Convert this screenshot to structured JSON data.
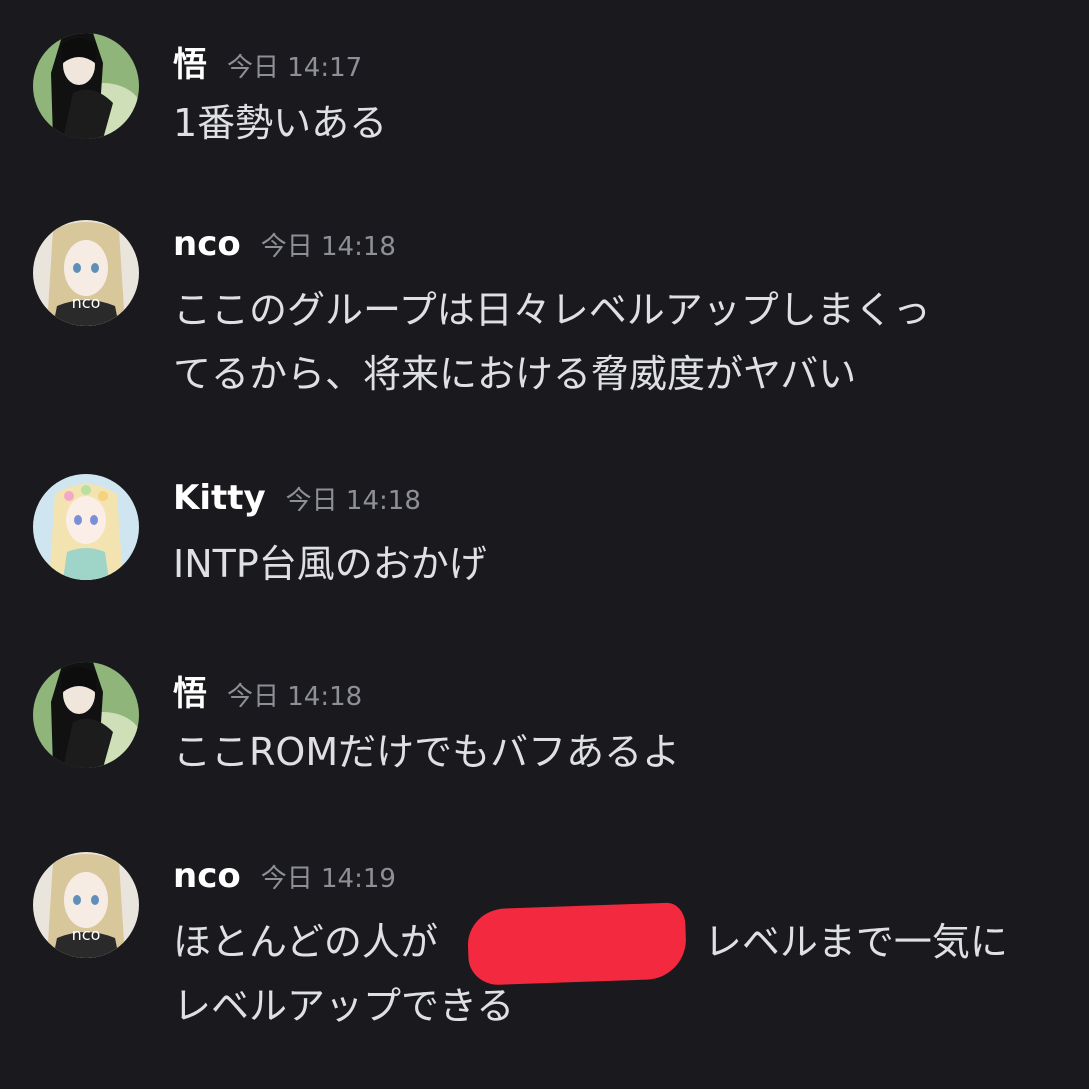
{
  "messages": [
    {
      "user": "悟",
      "time": "今日 14:17",
      "text": "1番勢いある"
    },
    {
      "user": "nco",
      "time": "今日 14:18",
      "text": "ここのグループは日々レベルアップしまくっ\nてるから、将来における脅威度がヤバい",
      "avatar_text": "nco"
    },
    {
      "user": "Kitty",
      "time": "今日 14:18",
      "text": "INTP台風のおかげ"
    },
    {
      "user": "悟",
      "time": "今日 14:18",
      "text": "ここROMだけでもバフあるよ"
    },
    {
      "user": "nco",
      "time": "今日 14:19",
      "text": "ほとんどの人が　　　　　　　レベルまで一気に\nレベルアップできる",
      "avatar_text": "nco"
    }
  ],
  "colors": {
    "background": "#1a1a1e",
    "username": "#ffffff",
    "timestamp": "#8e9097",
    "message": "#dfe0e3",
    "redaction": "#f2293f"
  },
  "icons": [
    "avatar-satoru",
    "avatar-nco",
    "avatar-kitty"
  ]
}
